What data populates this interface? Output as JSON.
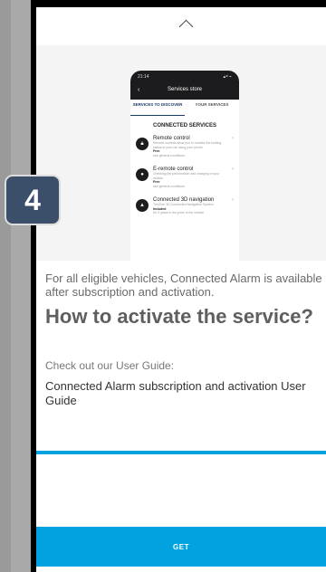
{
  "hero_mock": {
    "status_time": "21:14",
    "status_icons": "▴ᵃˡ ⌁",
    "header_title": "Services store",
    "tabs": [
      {
        "label": "SERVICES TO DISCOVER",
        "active": true
      },
      {
        "label": "YOUR SERVICES",
        "active": false
      }
    ],
    "section_title": "CONNECTED SERVICES",
    "items": [
      {
        "icon": "lock-icon",
        "title": "Remote control",
        "desc": "Remote controls allow you to monitor the locking status of your car using your phone.",
        "price": "Free",
        "price_note": "see general conditions"
      },
      {
        "icon": "battery-icon",
        "title": "E-remote control",
        "desc": "Checking the precondition and charging of your vehicle",
        "price": "Free",
        "price_note": "see general conditions"
      },
      {
        "icon": "navigation-icon",
        "title": "Connected 3D navigation",
        "desc": "TomTom 3D Connected Navigation System",
        "price": "Included",
        "price_note": "for 3 years in the price of the vehicle"
      }
    ]
  },
  "content": {
    "intro": "For all eligible vehicles, Connected Alarm is available after subscription and activation.",
    "heading": "How to activate the service?",
    "subtext": "Check out our User Guide:",
    "guide_link": "Connected Alarm subscription and activation User Guide"
  },
  "action_button": "GET",
  "step_badge": "4",
  "colors": {
    "accent": "#00a3e0",
    "badge": "#3b4f6b"
  }
}
